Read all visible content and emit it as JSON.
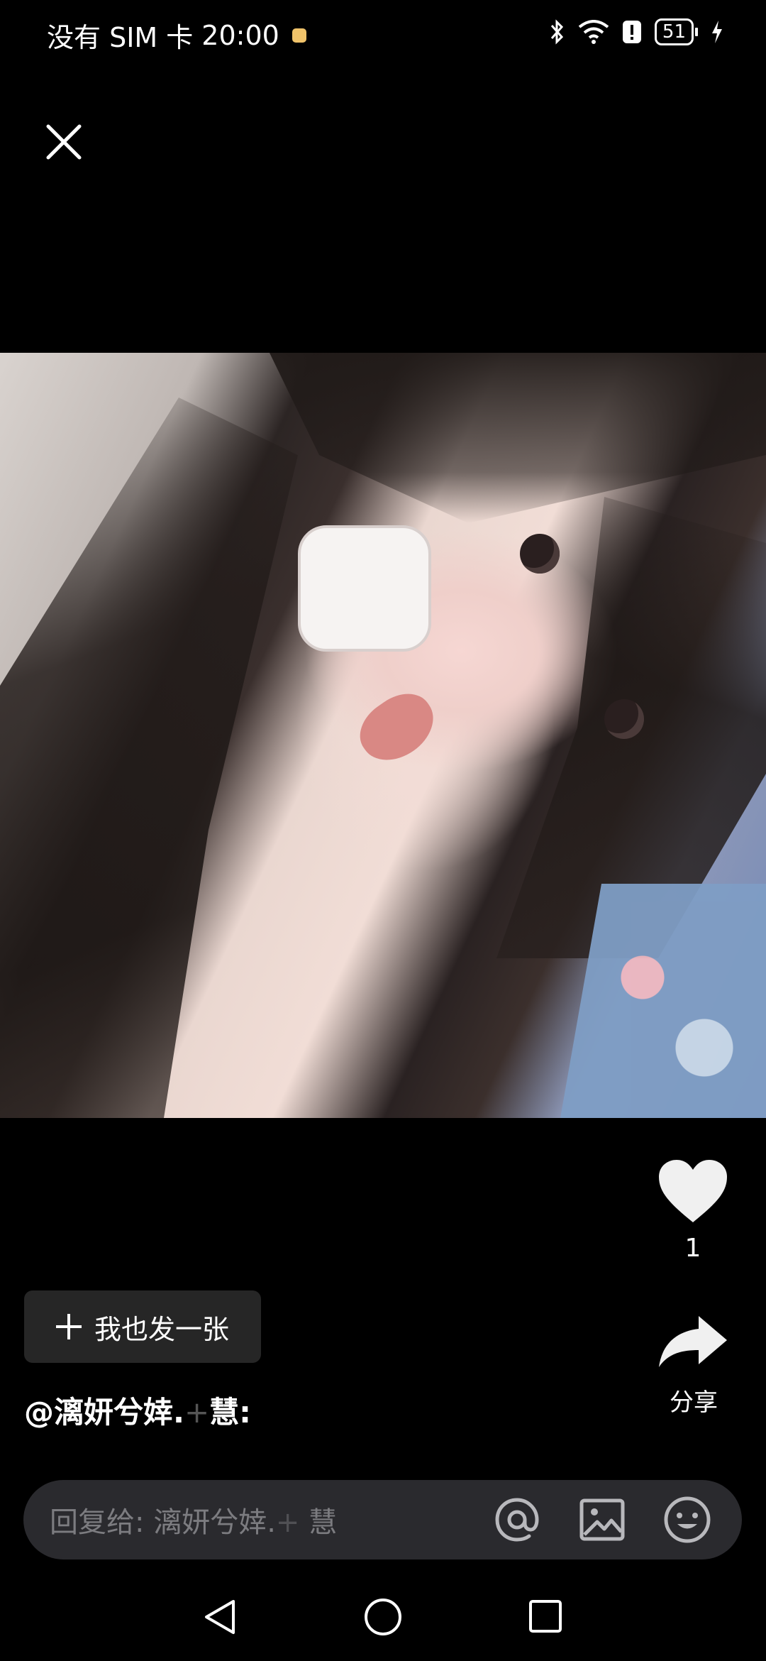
{
  "status_bar": {
    "carrier": "没有 SIM 卡",
    "time": "20:00",
    "battery_level": "51",
    "icons": [
      "bluetooth-icon",
      "wifi-icon",
      "alert-icon",
      "battery-icon",
      "charging-icon"
    ]
  },
  "viewer": {
    "close_icon": "close-icon",
    "likes": "1",
    "share_label": "分享"
  },
  "post_button": {
    "label": "我也发一张"
  },
  "mention": {
    "prefix": "@漓妍兮婞.",
    "cross": "+",
    "suffix": "慧:"
  },
  "reply": {
    "placeholder_main": "回复给: 漓妍兮婞.",
    "placeholder_cross": "+",
    "placeholder_end": " 慧",
    "icons": [
      "at-icon",
      "image-icon",
      "emoji-icon"
    ]
  },
  "navigation": {
    "icons": [
      "back-icon",
      "home-icon",
      "recent-apps-icon"
    ]
  },
  "colors": {
    "background": "#000000",
    "reply_bar": "#2a2a2e",
    "button_bg": "#262626"
  }
}
